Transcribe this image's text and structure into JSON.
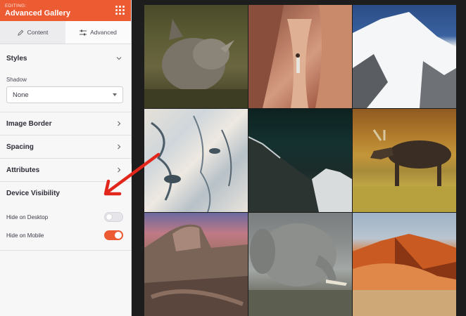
{
  "topbar": {
    "editing_label": "EDITING:",
    "title": "Advanced Gallery"
  },
  "tabs": [
    {
      "label": "Content",
      "icon": "pencil-icon",
      "active": false
    },
    {
      "label": "Advanced",
      "icon": "sliders-icon",
      "active": true
    }
  ],
  "styles": {
    "label": "Styles",
    "shadow_label": "Shadow",
    "shadow_value": "None"
  },
  "sections": {
    "image_border": "Image Border",
    "spacing": "Spacing",
    "attributes": "Attributes",
    "device_visibility": "Device Visibility"
  },
  "device_visibility": {
    "desktop_label": "Hide on Desktop",
    "desktop_on": false,
    "mobile_label": "Hide on Mobile",
    "mobile_on": true
  },
  "colors": {
    "accent": "#ED5B33",
    "annotation_arrow": "#E3261C",
    "canvas_bg": "#1D1D1D"
  },
  "gallery": {
    "images": [
      {
        "subject": "rhino"
      },
      {
        "subject": "slot canyon"
      },
      {
        "subject": "snowy mountain"
      },
      {
        "subject": "ice texture"
      },
      {
        "subject": "night mountain"
      },
      {
        "subject": "moose"
      },
      {
        "subject": "half dome"
      },
      {
        "subject": "elephant"
      },
      {
        "subject": "sand dunes"
      }
    ]
  }
}
